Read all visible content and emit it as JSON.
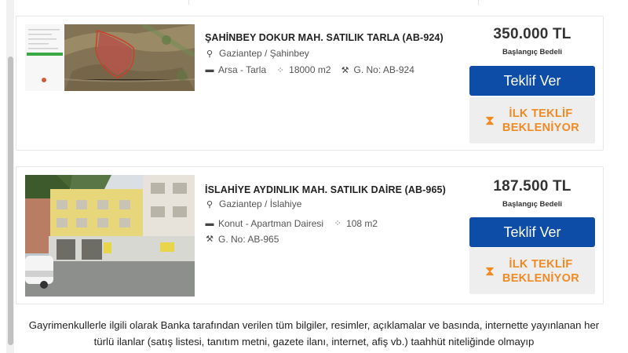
{
  "listings": [
    {
      "title": "ŞAHİNBEY DOKUR MAH. SATILIK TARLA (AB-924)",
      "location": "Gaziantep / Şahinbey",
      "type": "Arsa - Tarla",
      "area": "18000 m2",
      "gno": "G. No: AB-924",
      "price": "350.000 TL",
      "price_label": "Başlangıç Bedeli",
      "bid_label": "Teklif Ver",
      "wait_line1": "İLK TEKLİF",
      "wait_line2": "BEKLENİYOR"
    },
    {
      "title": "İSLAHİYE AYDINLIK MAH. SATILIK DAİRE (AB-965)",
      "location": "Gaziantep / İslahiye",
      "type": "Konut - Apartman Dairesi",
      "area": "108 m2",
      "gno": "G. No: AB-965",
      "price": "187.500 TL",
      "price_label": "Başlangıç Bedeli",
      "bid_label": "Teklif Ver",
      "wait_line1": "İLK TEKLİF",
      "wait_line2": "BEKLENİYOR"
    }
  ],
  "disclaimer": "Gayrimenkullerle ilgili olarak Banka tarafından verilen tüm bilgiler, resimler, açıklamalar ve basında, internette yayınlanan her türlü ilanlar (satış listesi, tanıtım metni, gazete ilanı, internet, afiş vb.) taahhüt niteliğinde olmayıp",
  "icons": {
    "location": "map-pin-icon",
    "type": "building-icon",
    "area": "area-icon",
    "gno": "parcel-icon",
    "wait": "hourglass-icon"
  },
  "colors": {
    "bid_button": "#0d4da8",
    "wait_text": "#f08a24",
    "wait_bg": "#eeeeee"
  }
}
